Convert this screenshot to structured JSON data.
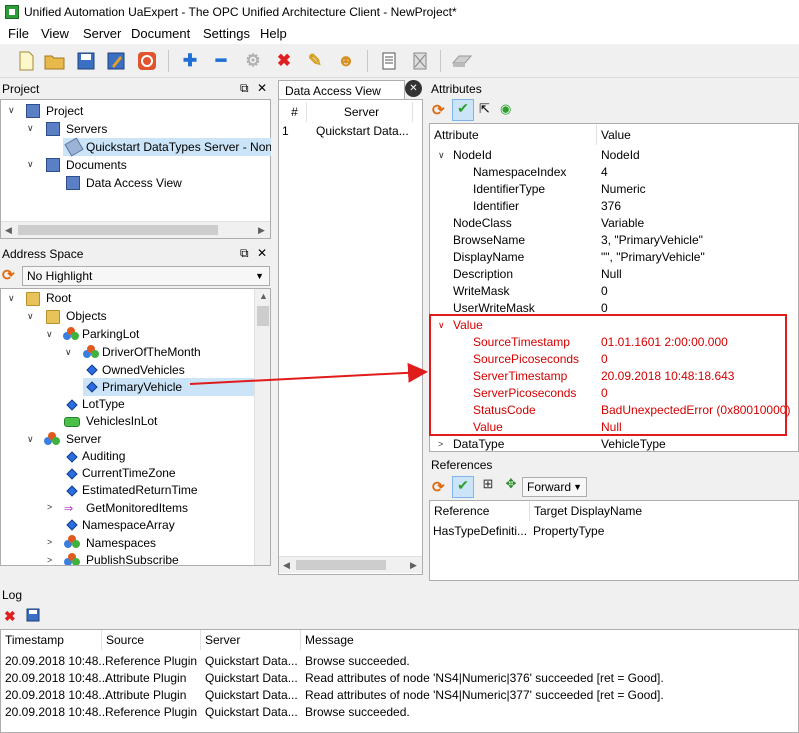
{
  "window": {
    "title": "Unified Automation UaExpert - The OPC Unified Architecture Client - NewProject*"
  },
  "menu": [
    "File",
    "View",
    "Server",
    "Document",
    "Settings",
    "Help"
  ],
  "project": {
    "header": "Project",
    "items": [
      "Project",
      "Servers",
      "Quickstart DataTypes Server - None",
      "Documents",
      "Data Access View"
    ]
  },
  "address_space": {
    "header": "Address Space",
    "highlight": "No Highlight",
    "items": [
      "Root",
      "Objects",
      "ParkingLot",
      "DriverOfTheMonth",
      "OwnedVehicles",
      "PrimaryVehicle",
      "LotType",
      "VehiclesInLot",
      "Server",
      "Auditing",
      "CurrentTimeZone",
      "EstimatedReturnTime",
      "GetMonitoredItems",
      "NamespaceArray",
      "Namespaces",
      "PublishSubscribe"
    ]
  },
  "dav": {
    "tab": "Data Access View",
    "columns": [
      "#",
      "Server"
    ],
    "rows": [
      [
        "1",
        "Quickstart Data..."
      ]
    ]
  },
  "attributes": {
    "header": "Attributes",
    "columns": [
      "Attribute",
      "Value"
    ],
    "rows": [
      [
        "NodeId",
        "NodeId"
      ],
      [
        "NamespaceIndex",
        "4"
      ],
      [
        "IdentifierType",
        "Numeric"
      ],
      [
        "Identifier",
        "376"
      ],
      [
        "NodeClass",
        "Variable"
      ],
      [
        "BrowseName",
        "3, \"PrimaryVehicle\""
      ],
      [
        "DisplayName",
        "\"\", \"PrimaryVehicle\""
      ],
      [
        "Description",
        "Null"
      ],
      [
        "WriteMask",
        "0"
      ],
      [
        "UserWriteMask",
        "0"
      ],
      [
        "Value",
        ""
      ],
      [
        "SourceTimestamp",
        "01.01.1601 2:00:00.000"
      ],
      [
        "SourcePicoseconds",
        "0"
      ],
      [
        "ServerTimestamp",
        "20.09.2018 10:48:18.643"
      ],
      [
        "ServerPicoseconds",
        "0"
      ],
      [
        "StatusCode",
        "BadUnexpectedError (0x80010000)"
      ],
      [
        "Value",
        "Null"
      ],
      [
        "DataType",
        "VehicleType"
      ]
    ]
  },
  "references": {
    "header": "References",
    "direction": "Forward",
    "columns": [
      "Reference",
      "Target DisplayName"
    ],
    "rows": [
      [
        "HasTypeDefiniti...",
        "PropertyType"
      ]
    ]
  },
  "log": {
    "header": "Log",
    "columns": [
      "Timestamp",
      "Source",
      "Server",
      "Message"
    ],
    "rows": [
      [
        "20.09.2018 10:48...",
        "Reference Plugin",
        "Quickstart Data...",
        "Browse succeeded."
      ],
      [
        "20.09.2018 10:48...",
        "Attribute Plugin",
        "Quickstart Data...",
        "Read attributes of node 'NS4|Numeric|376' succeeded [ret = Good]."
      ],
      [
        "20.09.2018 10:48...",
        "Attribute Plugin",
        "Quickstart Data...",
        "Read attributes of node 'NS4|Numeric|377' succeeded [ret = Good]."
      ],
      [
        "20.09.2018 10:48...",
        "Reference Plugin",
        "Quickstart Data...",
        "Browse succeeded."
      ]
    ]
  },
  "colors": {
    "error_red": "#d40000",
    "highlight_box": "#e01b1b",
    "selection": "#cce4f7"
  }
}
